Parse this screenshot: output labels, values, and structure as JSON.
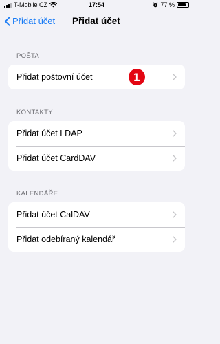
{
  "status_bar": {
    "carrier": "T-Mobile CZ",
    "time": "17:54",
    "battery": "77 %",
    "battery_level": 0.77
  },
  "nav": {
    "back_label": "Přidat účet",
    "title": "Přidat účet"
  },
  "sections": {
    "posta": {
      "header": "POŠTA",
      "items": [
        {
          "label": "Přidat poštovní účet"
        }
      ],
      "badge": "1"
    },
    "kontakty": {
      "header": "KONTAKTY",
      "items": [
        {
          "label": "Přidat účet LDAP"
        },
        {
          "label": "Přidat účet CardDAV"
        }
      ]
    },
    "kalendare": {
      "header": "KALENDÁŘE",
      "items": [
        {
          "label": "Přidat účet CalDAV"
        },
        {
          "label": "Přidat odebíraný kalendář"
        }
      ]
    }
  },
  "colors": {
    "accent": "#1a7cf5",
    "background": "#f2f2f7",
    "badge": "#e30613"
  },
  "icons": [
    "signal-icon",
    "wifi-icon",
    "alarm-icon",
    "battery-icon",
    "back-chevron-icon",
    "chevron-right-icon"
  ]
}
